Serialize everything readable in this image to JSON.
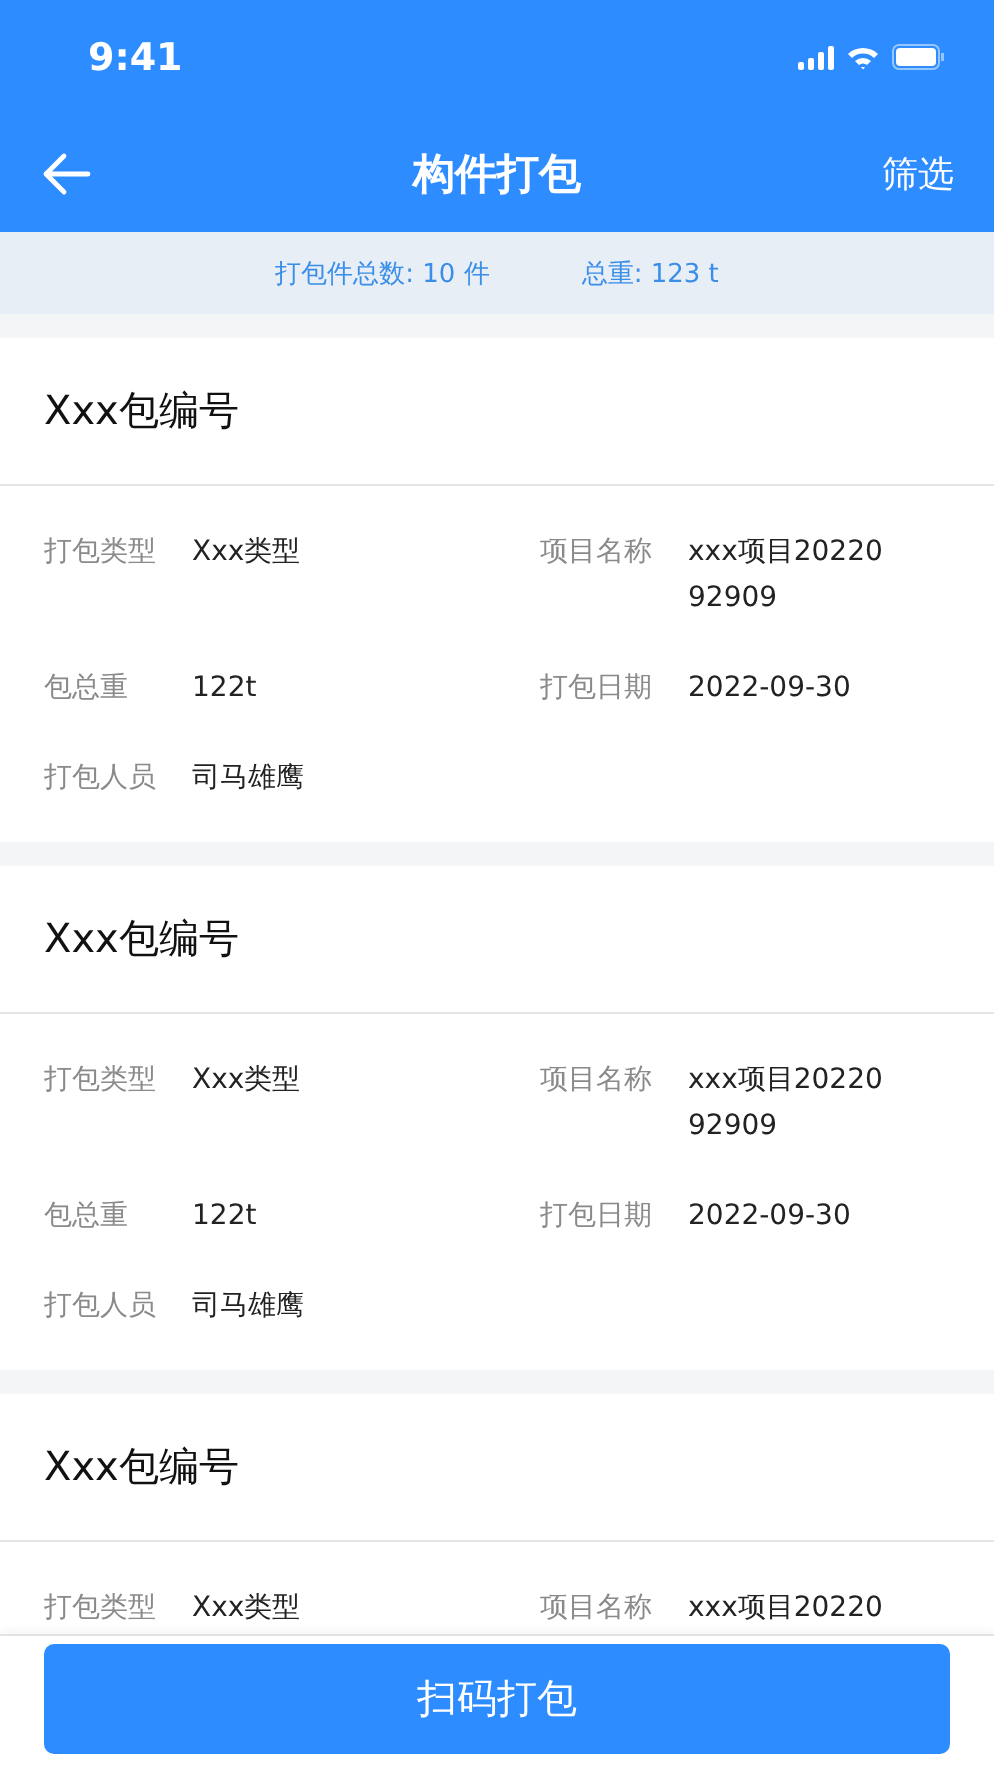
{
  "status_bar": {
    "time": "9:41"
  },
  "nav": {
    "title": "构件打包",
    "action": "筛选"
  },
  "summary": [
    {
      "text": "打包件总数: 10 件"
    },
    {
      "text": "总重: 123 t"
    }
  ],
  "packages": [
    {
      "title": "Xxx包编号",
      "fields": [
        {
          "label": "打包类型",
          "value": "Xxx类型"
        },
        {
          "label": "项目名称",
          "value": "xxx项目2022092909"
        },
        {
          "label": "包总重",
          "value": "122t"
        },
        {
          "label": "打包日期",
          "value": "2022-09-30"
        },
        {
          "label": "打包人员",
          "value": "司马雄鹰"
        }
      ]
    },
    {
      "title": "Xxx包编号",
      "fields": [
        {
          "label": "打包类型",
          "value": "Xxx类型"
        },
        {
          "label": "项目名称",
          "value": "xxx项目2022092909"
        },
        {
          "label": "包总重",
          "value": "122t"
        },
        {
          "label": "打包日期",
          "value": "2022-09-30"
        },
        {
          "label": "打包人员",
          "value": "司马雄鹰"
        }
      ]
    },
    {
      "title": "Xxx包编号",
      "fields": [
        {
          "label": "打包类型",
          "value": "Xxx类型"
        },
        {
          "label": "项目名称",
          "value": "xxx项目20220"
        }
      ]
    }
  ],
  "primary_button": "扫码打包"
}
